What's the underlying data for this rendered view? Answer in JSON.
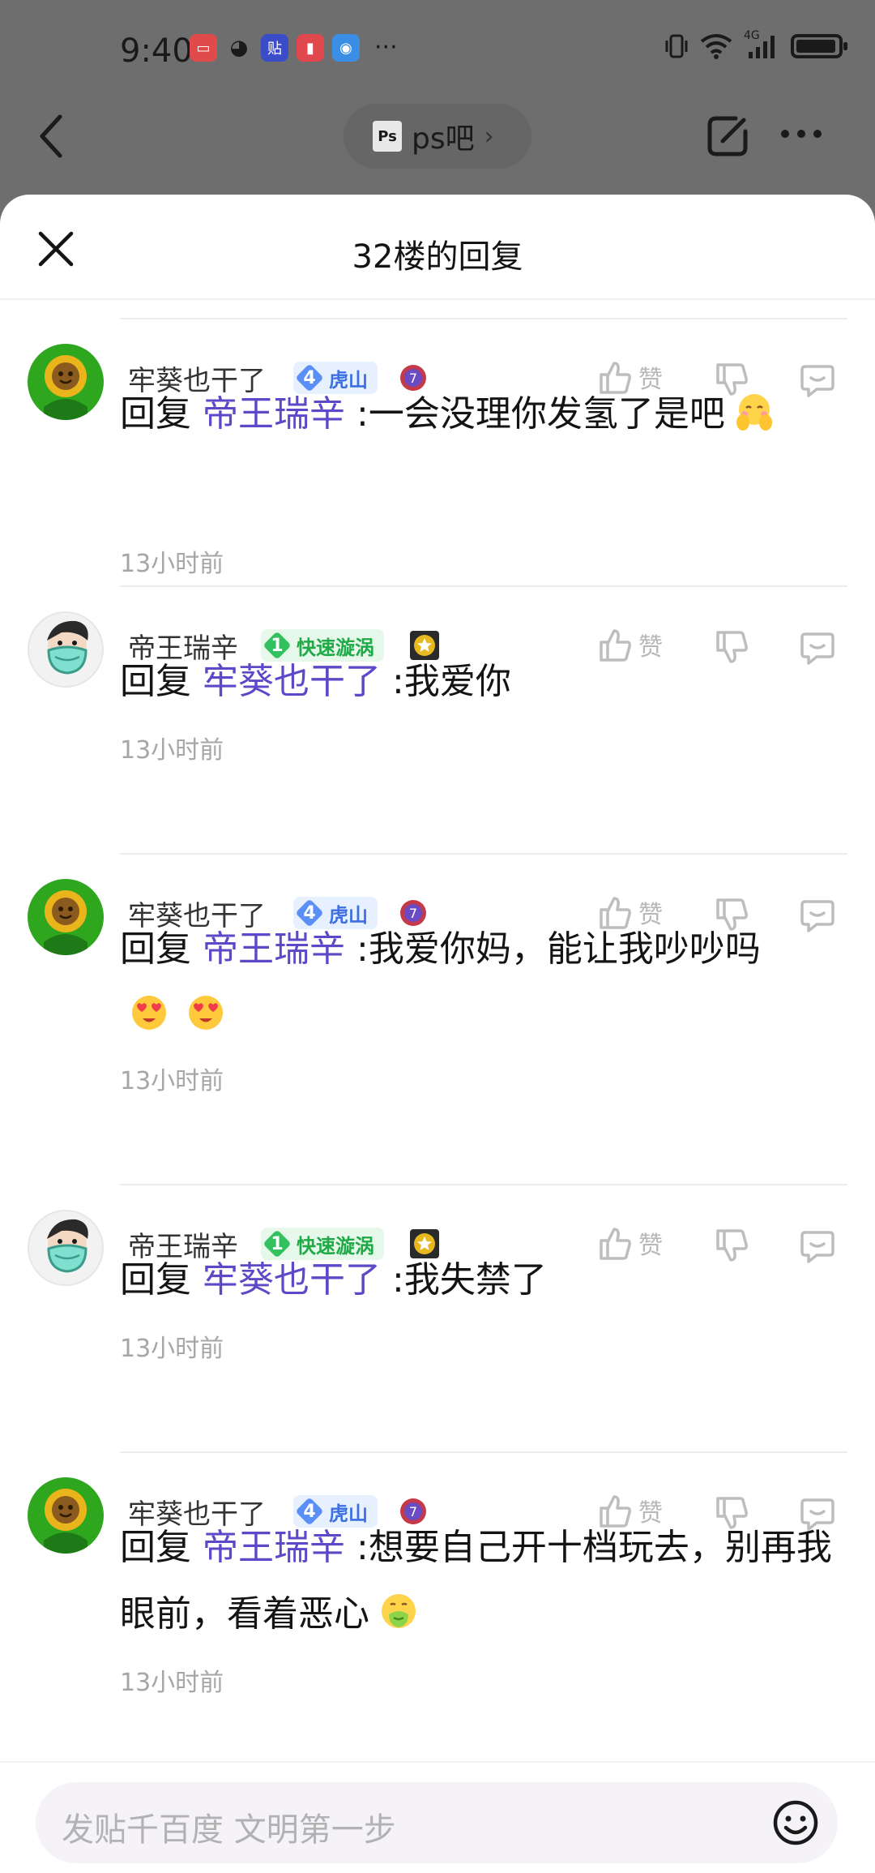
{
  "status_bar": {
    "time": "9:40",
    "network": "4G"
  },
  "app_bar": {
    "forum_logo": "Ps",
    "forum_name": "ps吧"
  },
  "sheet": {
    "title": "32楼的回复"
  },
  "replies": [
    {
      "user": "牢葵也干了",
      "level": "4",
      "level_name": "虎山",
      "badge_color": "blue",
      "avatar": "sunflower",
      "like_label": "赞",
      "reply_prefix": "回复",
      "mention": "帝王瑞辛",
      "text": ":一会没理你发氢了是吧",
      "emojis": [
        "blush-hands-emoji"
      ],
      "time": "13小时前"
    },
    {
      "user": "帝王瑞辛",
      "level": "1",
      "level_name": "快速漩涡",
      "badge_color": "green",
      "avatar": "masked-face",
      "like_label": "赞",
      "reply_prefix": "回复",
      "mention": "牢葵也干了",
      "text": ":我爱你",
      "emojis": [],
      "time": "13小时前"
    },
    {
      "user": "牢葵也干了",
      "level": "4",
      "level_name": "虎山",
      "badge_color": "blue",
      "avatar": "sunflower",
      "like_label": "赞",
      "reply_prefix": "回复",
      "mention": "帝王瑞辛",
      "text": ":我爱你妈，能让我吵吵吗",
      "emojis": [
        "heart-eyes-emoji",
        "heart-eyes-emoji"
      ],
      "time": "13小时前"
    },
    {
      "user": "帝王瑞辛",
      "level": "1",
      "level_name": "快速漩涡",
      "badge_color": "green",
      "avatar": "masked-face",
      "like_label": "赞",
      "reply_prefix": "回复",
      "mention": "牢葵也干了",
      "text": ":我失禁了",
      "emojis": [],
      "time": "13小时前"
    },
    {
      "user": "牢葵也干了",
      "level": "4",
      "level_name": "虎山",
      "badge_color": "blue",
      "avatar": "sunflower",
      "like_label": "赞",
      "reply_prefix": "回复",
      "mention": "帝王瑞辛",
      "text": ":想要自己开十档玩去，别再我眼前，看着恶心",
      "emojis": [
        "nauseated-emoji"
      ],
      "time": "13小时前"
    }
  ],
  "composer": {
    "placeholder": "发贴千百度 文明第一步"
  },
  "colors": {
    "mention": "#5d48c8",
    "sheet_bg": "#ffffff",
    "overlay": "#6e6e6e"
  }
}
